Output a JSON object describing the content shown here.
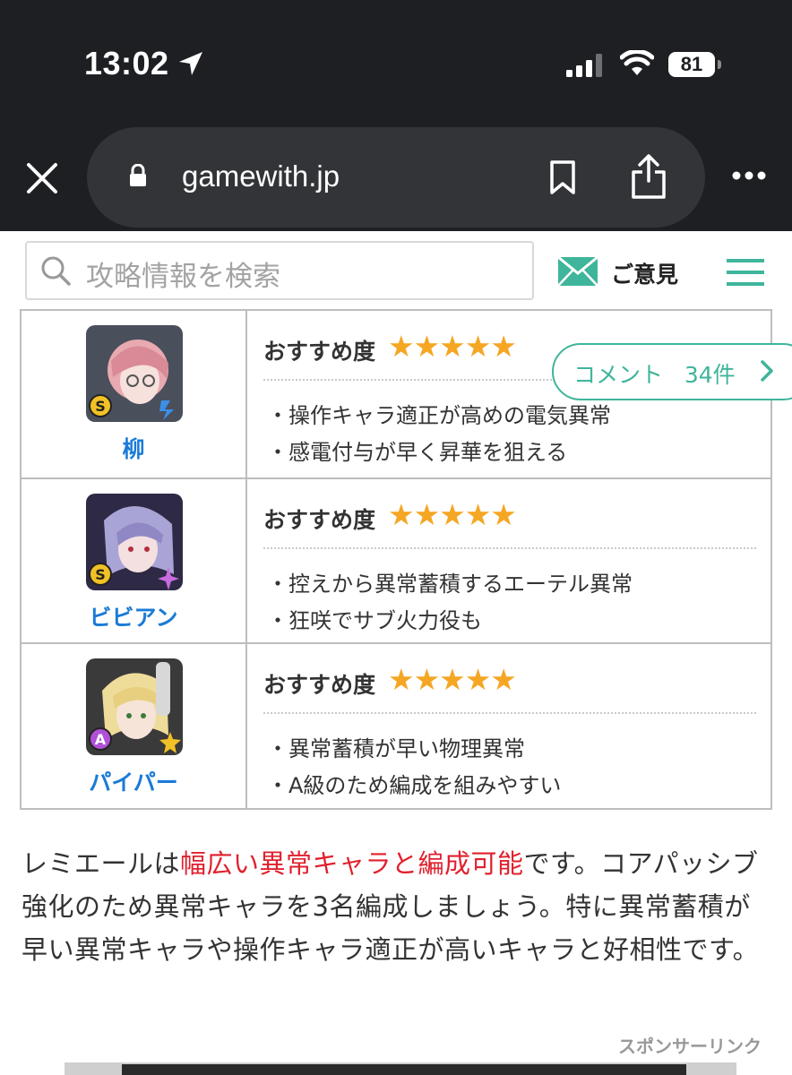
{
  "status_bar": {
    "time": "13:02",
    "battery": "81"
  },
  "browser": {
    "url": "gamewith.jp"
  },
  "site_header": {
    "search_placeholder": "攻略情報を検索",
    "opinion_label": "ご意見"
  },
  "comment_button": {
    "label": "コメント",
    "count": "34件"
  },
  "characters": [
    {
      "name": "柳",
      "rec_label": "おすすめ度",
      "stars": "★★★★★",
      "rank": "S",
      "points": [
        "・操作キャラ適正が高めの電気異常",
        "・感電付与が早く昇華を狙える"
      ]
    },
    {
      "name": "ビビアン",
      "rec_label": "おすすめ度",
      "stars": "★★★★★",
      "rank": "S",
      "points": [
        "・控えから異常蓄積するエーテル異常",
        "・狂咲でサブ火力役も"
      ]
    },
    {
      "name": "パイパー",
      "rec_label": "おすすめ度",
      "stars": "★★★★★",
      "rank": "A",
      "points": [
        "・異常蓄積が早い物理異常",
        "・A級のため編成を組みやすい"
      ]
    }
  ],
  "paragraph": {
    "part1": "レミエールは",
    "highlight": "幅広い異常キャラと編成可能",
    "part2": "です。コアパッシブ強化のため異常キャラを3名編成しましょう。特に異常蓄積が早い異常キャラや操作キャラ適正が高いキャラと好相性です。"
  },
  "sponsor_label": "スポンサーリンク",
  "colors": {
    "accent": "#3fb59b",
    "link": "#1a7bd7",
    "star": "#f5a623",
    "highlight": "#e0212e"
  }
}
